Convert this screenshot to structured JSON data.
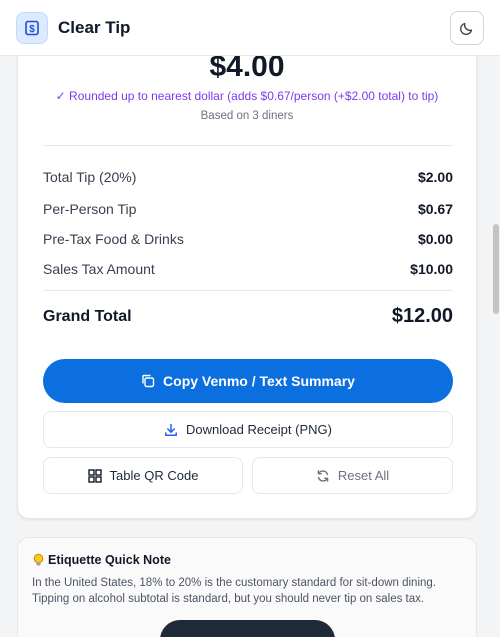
{
  "header": {
    "app_title": "Clear Tip",
    "logo_icon": "dollar-receipt-icon",
    "theme_toggle_icon": "moon-icon"
  },
  "summary": {
    "per_person_amount": "$4.00",
    "rounded_note": "✓ Rounded up to nearest dollar (adds $0.67/person (+$2.00 total) to tip)",
    "based_on": "Based on 3 diners"
  },
  "breakdown": [
    {
      "label": "Total Tip (20%)",
      "value": "$2.00"
    },
    {
      "label": "Per-Person Tip",
      "value": "$0.67"
    },
    {
      "label": "Pre-Tax Food & Drinks",
      "value": "$0.00"
    },
    {
      "label": "Sales Tax Amount",
      "value": "$10.00"
    }
  ],
  "grand_total": {
    "label": "Grand Total",
    "value": "$12.00"
  },
  "actions": {
    "copy_label": "Copy Venmo / Text Summary",
    "download_label": "Download Receipt (PNG)",
    "qr_label": "Table QR Code",
    "reset_label": "Reset All"
  },
  "etiquette": {
    "title": "Etiquette Quick Note",
    "body": "In the United States, 18% to 20% is the customary standard for sit-down dining. Tipping on alcohol subtotal is standard, but you should never tip on sales tax."
  },
  "colors": {
    "primary": "#0b6fe0",
    "accent_purple": "#7c3aed"
  }
}
